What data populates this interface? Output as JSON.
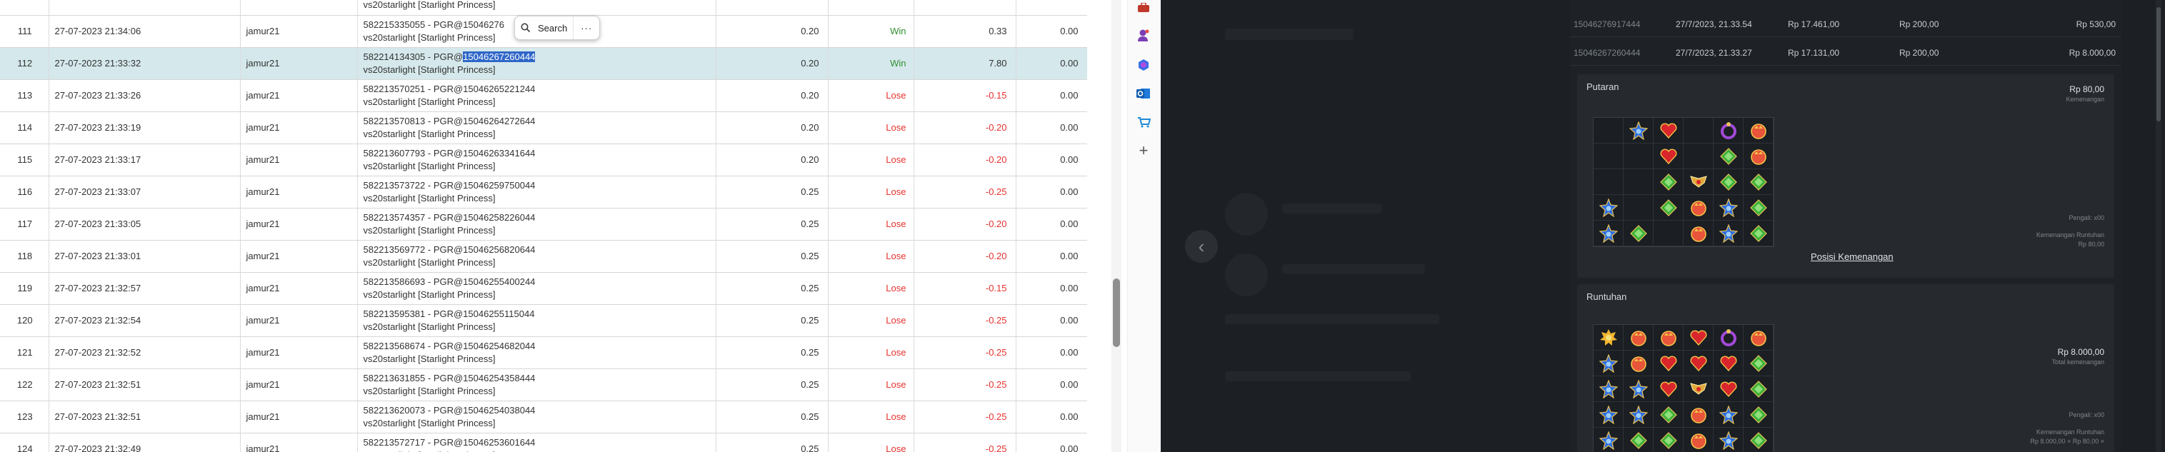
{
  "context_menu": {
    "search_label": "Search",
    "more_label": "···"
  },
  "rows": [
    {
      "no": "111",
      "date": "27-07-2023 21:34:06",
      "user": "jamur21",
      "game_line1": "582215335055 - PGR@15046276",
      "game_line2": "vs20starlight [Starlight Princess]",
      "bet": "0.20",
      "result": "Win",
      "winamt": "0.33",
      "last": "0.00"
    },
    {
      "no": "112",
      "date": "27-07-2023 21:33:32",
      "user": "jamur21",
      "game_line1": "582214134305 - PGR@",
      "game_hl": "15046267260444",
      "game_line2": "vs20starlight [Starlight Princess]",
      "bet": "0.20",
      "result": "Win",
      "winamt": "7.80",
      "last": "0.00",
      "selected": true
    },
    {
      "no": "113",
      "date": "27-07-2023 21:33:26",
      "user": "jamur21",
      "game_line1": "582213570251 - PGR@15046265221244",
      "game_line2": "vs20starlight [Starlight Princess]",
      "bet": "0.20",
      "result": "Lose",
      "winamt": "-0.15",
      "last": "0.00"
    },
    {
      "no": "114",
      "date": "27-07-2023 21:33:19",
      "user": "jamur21",
      "game_line1": "582213570813 - PGR@15046264272644",
      "game_line2": "vs20starlight [Starlight Princess]",
      "bet": "0.20",
      "result": "Lose",
      "winamt": "-0.20",
      "last": "0.00"
    },
    {
      "no": "115",
      "date": "27-07-2023 21:33:17",
      "user": "jamur21",
      "game_line1": "582213607793 - PGR@15046263341644",
      "game_line2": "vs20starlight [Starlight Princess]",
      "bet": "0.20",
      "result": "Lose",
      "winamt": "-0.20",
      "last": "0.00"
    },
    {
      "no": "116",
      "date": "27-07-2023 21:33:07",
      "user": "jamur21",
      "game_line1": "582213573722 - PGR@15046259750044",
      "game_line2": "vs20starlight [Starlight Princess]",
      "bet": "0.25",
      "result": "Lose",
      "winamt": "-0.25",
      "last": "0.00"
    },
    {
      "no": "117",
      "date": "27-07-2023 21:33:05",
      "user": "jamur21",
      "game_line1": "582213574357 - PGR@15046258226044",
      "game_line2": "vs20starlight [Starlight Princess]",
      "bet": "0.25",
      "result": "Lose",
      "winamt": "-0.20",
      "last": "0.00"
    },
    {
      "no": "118",
      "date": "27-07-2023 21:33:01",
      "user": "jamur21",
      "game_line1": "582213569772 - PGR@15046256820644",
      "game_line2": "vs20starlight [Starlight Princess]",
      "bet": "0.25",
      "result": "Lose",
      "winamt": "-0.20",
      "last": "0.00"
    },
    {
      "no": "119",
      "date": "27-07-2023 21:32:57",
      "user": "jamur21",
      "game_line1": "582213586693 - PGR@15046255400244",
      "game_line2": "vs20starlight [Starlight Princess]",
      "bet": "0.25",
      "result": "Lose",
      "winamt": "-0.15",
      "last": "0.00"
    },
    {
      "no": "120",
      "date": "27-07-2023 21:32:54",
      "user": "jamur21",
      "game_line1": "582213595381 - PGR@15046255115044",
      "game_line2": "vs20starlight [Starlight Princess]",
      "bet": "0.25",
      "result": "Lose",
      "winamt": "-0.25",
      "last": "0.00"
    },
    {
      "no": "121",
      "date": "27-07-2023 21:32:52",
      "user": "jamur21",
      "game_line1": "582213568674 - PGR@15046254682044",
      "game_line2": "vs20starlight [Starlight Princess]",
      "bet": "0.25",
      "result": "Lose",
      "winamt": "-0.25",
      "last": "0.00"
    },
    {
      "no": "122",
      "date": "27-07-2023 21:32:51",
      "user": "jamur21",
      "game_line1": "582213631855 - PGR@15046254358444",
      "game_line2": "vs20starlight [Starlight Princess]",
      "bet": "0.25",
      "result": "Lose",
      "winamt": "-0.25",
      "last": "0.00"
    },
    {
      "no": "123",
      "date": "27-07-2023 21:32:51",
      "user": "jamur21",
      "game_line1": "582213620073 - PGR@15046254038044",
      "game_line2": "vs20starlight [Starlight Princess]",
      "bet": "0.25",
      "result": "Lose",
      "winamt": "-0.25",
      "last": "0.00"
    },
    {
      "no": "124",
      "date": "27-07-2023 21:32:49",
      "user": "jamur21",
      "game_line1": "582213572717 - PGR@15046253601644",
      "game_line2": "vs20starlight [Starlight Princess]",
      "bet": "0.25",
      "result": "Lose",
      "winamt": "-0.25",
      "last": "0.00"
    }
  ],
  "top_partial_text": "vs20starlight [Starlight Princess]",
  "history": [
    {
      "id": "15046276917444",
      "time": "27/7/2023, 21.33.54",
      "balance": "Rp 17.461,00",
      "bet": "Rp 200,00",
      "win": "Rp 530,00"
    },
    {
      "id": "15046267260444",
      "time": "27/7/2023, 21.33.27",
      "balance": "Rp 17.131,00",
      "bet": "Rp 200,00",
      "win": "Rp 8.000,00"
    }
  ],
  "putaran": {
    "title": "Putaran",
    "amount": "Rp 80,00",
    "amount_sub": "Kemenangan",
    "note1": "Pengali: x00",
    "note2": "Kemenangan Runtuhan",
    "note3": "Rp 80,00",
    "link": "Posisi Kemenangan",
    "grid": [
      [
        "",
        "blue-star",
        "red-heart",
        "",
        "purple-ring",
        "orange-crown"
      ],
      [
        "",
        "",
        "red-heart",
        "",
        "green-gem",
        "orange-crown"
      ],
      [
        "",
        "",
        "green-gem",
        "gold-wings",
        "green-gem",
        "green-gem"
      ],
      [
        "blue-star",
        "",
        "green-gem",
        "orange-crown",
        "blue-star",
        "green-gem"
      ],
      [
        "blue-star",
        "green-gem",
        "",
        "orange-crown",
        "blue-star",
        "green-gem"
      ]
    ]
  },
  "runtuhan": {
    "title": "Runtuhan",
    "amount": "Rp 8.000,00",
    "amount_sub": "Total kemenangan",
    "note1": "Pengali: x00",
    "note2": "Kemenangan Runtuhan",
    "note3": "Rp 8.000,00 × Rp 80,00 ×",
    "grid": [
      [
        "gold-sun",
        "orange-crown",
        "orange-crown",
        "red-heart",
        "purple-ring",
        "orange-crown"
      ],
      [
        "blue-star",
        "orange-crown",
        "red-heart",
        "red-heart",
        "red-heart",
        "green-gem"
      ],
      [
        "blue-star",
        "blue-star",
        "red-heart",
        "gold-wings",
        "red-heart",
        "green-gem"
      ],
      [
        "blue-star",
        "blue-star",
        "green-gem",
        "orange-crown",
        "blue-star",
        "green-gem"
      ],
      [
        "blue-star",
        "green-gem",
        "green-gem",
        "orange-crown",
        "blue-star",
        "green-gem"
      ]
    ]
  },
  "colors": {
    "win": "#2f8f2f",
    "lose": "#e5322f",
    "selected_row": "#d5e8ec",
    "highlight": "#2f67c9",
    "dark_bg": "#1c1f23"
  }
}
